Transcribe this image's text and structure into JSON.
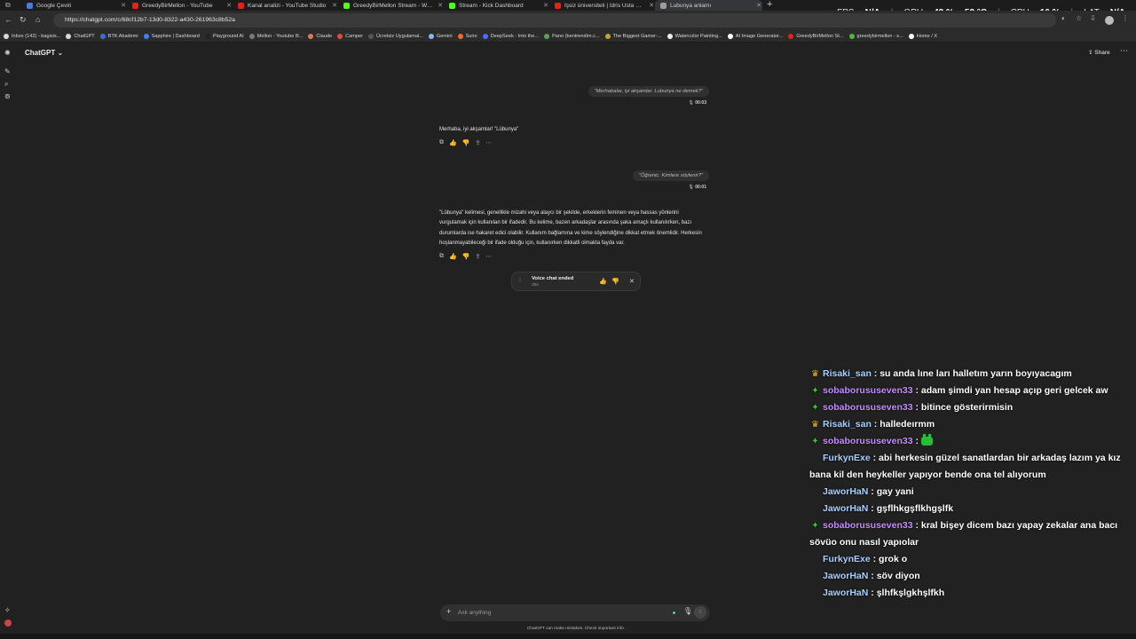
{
  "browser": {
    "tabs": [
      {
        "title": "Google Çeviri",
        "favicon_color": "#4a7bd6"
      },
      {
        "title": "GreedyBirMellon - YouTube",
        "favicon_color": "#e62117"
      },
      {
        "title": "Kanal analizi - YouTube Studio",
        "favicon_color": "#e62117"
      },
      {
        "title": "GreedyBirMellon Stream - Watch",
        "favicon_color": "#53fc18"
      },
      {
        "title": "Stream - Kick Dashboard",
        "favicon_color": "#53fc18"
      },
      {
        "title": "İşsiz üniversiteli | İdris Usta USA !",
        "favicon_color": "#e62117"
      },
      {
        "title": "Lubunya anlamı",
        "favicon_color": "#9c9c9c"
      }
    ],
    "url": "https://chatgpt.com/c/68cf12b7-13d0-8322-a430-261963c8b52a",
    "bookmarks": [
      {
        "label": "Inbox (142) - bagisis...",
        "color": "#d9d9d9"
      },
      {
        "label": "ChatGPT",
        "color": "#d9d9d9"
      },
      {
        "label": "BTK Akademi",
        "color": "#3d6fd0"
      },
      {
        "label": "Sapphire | Dashboard",
        "color": "#3b82f6"
      },
      {
        "label": "Playground AI",
        "color": "#222222"
      },
      {
        "label": "Mellon - Youtube B...",
        "color": "#7a7a7a"
      },
      {
        "label": "Claude",
        "color": "#d97757"
      },
      {
        "label": "Camper",
        "color": "#e04b3c"
      },
      {
        "label": "Ücretsiz Uygulamal...",
        "color": "#555555"
      },
      {
        "label": "Gemini",
        "color": "#8ab4f8"
      },
      {
        "label": "Suno",
        "color": "#f06a2a"
      },
      {
        "label": "DeepSeek - Into the...",
        "color": "#4d6bfe"
      },
      {
        "label": "Pano (bentrendim.c...",
        "color": "#5aa05a"
      },
      {
        "label": "The Biggest Gamer-...",
        "color": "#c9a227"
      },
      {
        "label": "Watercolor Painting...",
        "color": "#eeeeee"
      },
      {
        "label": "AI Image Generator...",
        "color": "#ffffff"
      },
      {
        "label": "GreedyBirMellon St...",
        "color": "#e62117"
      },
      {
        "label": "greedybirmellon - s...",
        "color": "#53b83a"
      },
      {
        "label": "Home / X",
        "color": "#ffffff"
      }
    ]
  },
  "perf_overlay": {
    "fps_label": "FPS",
    "fps_value": "N/A",
    "gpu_label": "GPU",
    "gpu_value": "42 %",
    "gpu_temp": "52 °C",
    "cpu_label": "CPU",
    "cpu_value": "16 %",
    "lat_label": "LAT",
    "lat_value": "N/A"
  },
  "app": {
    "model_title": "ChatGPT",
    "share_label": "Share",
    "composer_placeholder": "Ask anything",
    "disclaimer": "ChatGPT can make mistakes. Check important info."
  },
  "conversation": {
    "user1": {
      "text": "\"Merhabalar, iyi akşamlar. Lubunya ne demek?\"",
      "duration": "00:03"
    },
    "assistant1": {
      "text": "Merhaba, iyi akşamlar! \"Lübunya\""
    },
    "user2": {
      "text": "\"Öğrenic. Kimlere söylenir?\"",
      "duration": "00:01"
    },
    "assistant2": {
      "text": "\"Lübunya\" kelimesi, genellikle mizahi veya alaycı bir şekilde, erkeklerin feminen veya hassas yönlerini vurgulamak için kullanılan bir ifadedir. Bu kelime, bazen arkadaşlar arasında şaka amaçlı kullanılırken, bazı durumlarda ise hakaret edici olabilir. Kullanım bağlamına ve kime söylendiğine dikkat etmek önemlidir. Herkesin hoşlanmayabileceği bir ifade olduğu için, kullanırken dikkatli olmakta fayda var."
    },
    "voice_banner": {
      "title": "Voice chat ended",
      "duration": "35s"
    }
  },
  "stream_chat": [
    {
      "badge": "crown",
      "badge_color": "#f2b92a",
      "nick": "Risaki_san",
      "nick_color": "#a8d0ff",
      "text": ": su anda lıne ları halletım yarın boyıyacagım"
    },
    {
      "badge": "sparkle",
      "badge_color": "#36c93b",
      "nick": "sobaborususeven33",
      "nick_color": "#c58cff",
      "text": ": adam şimdi yan hesap açıp geri gelcek aw"
    },
    {
      "badge": "sparkle",
      "badge_color": "#36c93b",
      "nick": "sobaborususeven33",
      "nick_color": "#c58cff",
      "text": ": bitince gösterirmisin"
    },
    {
      "badge": "crown",
      "badge_color": "#f2b92a",
      "nick": "Risaki_san",
      "nick_color": "#a8d0ff",
      "text": ": halledeırmm"
    },
    {
      "badge": "sparkle",
      "badge_color": "#36c93b",
      "nick": "sobaborususeven33",
      "nick_color": "#c58cff",
      "text": ":",
      "emote": true
    },
    {
      "badge": "",
      "badge_color": "",
      "nick": "FurkynExe",
      "nick_color": "#a8d0ff",
      "text": ": abi herkesin güzel sanatlardan bir arkadaş lazım ya kız bana kil den heykeller yapıyor bende ona tel alıyorum"
    },
    {
      "badge": "",
      "badge_color": "",
      "nick": "JaworHaN",
      "nick_color": "#a8d0ff",
      "text": ": gay yani"
    },
    {
      "badge": "",
      "badge_color": "",
      "nick": "JaworHaN",
      "nick_color": "#a8d0ff",
      "text": ": gşflhkgşflkhgşlfk"
    },
    {
      "badge": "sparkle",
      "badge_color": "#36c93b",
      "nick": "sobaborususeven33",
      "nick_color": "#c58cff",
      "text": ": kral bişey dicem bazı yapay zekalar ana bacı sövüo onu nasıl yapıolar"
    },
    {
      "badge": "",
      "badge_color": "",
      "nick": "FurkynExe",
      "nick_color": "#a8d0ff",
      "text": ": grok o"
    },
    {
      "badge": "",
      "badge_color": "",
      "nick": "JaworHaN",
      "nick_color": "#a8d0ff",
      "text": ": söv diyon"
    },
    {
      "badge": "",
      "badge_color": "",
      "nick": "JaworHaN",
      "nick_color": "#a8d0ff",
      "text": ": şlhfkşlgkhşlfkh"
    }
  ]
}
